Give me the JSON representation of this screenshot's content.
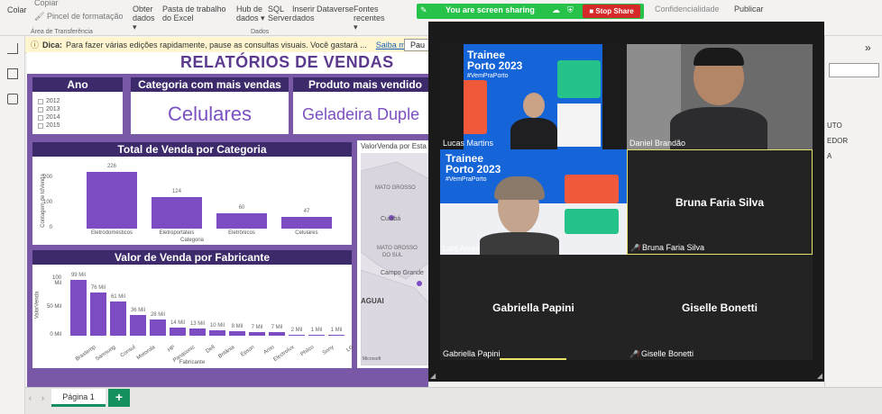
{
  "ribbon": {
    "items": [
      {
        "label": "Colar"
      },
      {
        "label": "Copiar"
      },
      {
        "label": "Pincel de formatação"
      },
      {
        "label": "Obter dados ▾"
      },
      {
        "label": "Pasta de trabalho do Excel"
      },
      {
        "label": "Hub de dados ▾"
      },
      {
        "label": "SQL Server"
      },
      {
        "label": "Inserir dados"
      },
      {
        "label": "Dataverse"
      },
      {
        "label": "Fontes recentes ▾"
      },
      {
        "label": "Confidencialidade"
      },
      {
        "label": "Publicar"
      }
    ],
    "group_clipboard": "Área de Transferência",
    "group_data": "Dados"
  },
  "infobar": {
    "prefix": "Dica:",
    "text": "Para fazer várias edições rapidamente, pause as consultas visuais. Você gastará ...",
    "link": "Saiba mais",
    "pause_button": "Pau"
  },
  "report": {
    "title": "RELATÓRIOS DE VENDAS",
    "ano": {
      "header": "Ano",
      "years": [
        "2012",
        "2013",
        "2014",
        "2015"
      ]
    },
    "categoria": {
      "header": "Categoria com mais vendas",
      "value": "Celulares"
    },
    "produto": {
      "header": "Produto mais vendido",
      "value": "Geladeira Duple"
    },
    "map_title": "ValorVenda por Esta",
    "map_labels": [
      "MATO GROSSO",
      "Cuiabá",
      "MATO GROSSO",
      "DO SUL",
      "Campo Grande",
      "AGUAI",
      "Microsoft"
    ]
  },
  "chart_data": [
    {
      "type": "bar",
      "title": "Total de Venda por Categoria",
      "categories": [
        "Eletrodomésticos",
        "Eletroportáteis",
        "Eletrônicos",
        "Celulares"
      ],
      "values": [
        226,
        124,
        60,
        47
      ],
      "xlabel": "Categoria",
      "ylabel": "Contagem de IdVenda",
      "yticks": [
        "0",
        "100",
        "200"
      ],
      "ylim": [
        0,
        250
      ]
    },
    {
      "type": "bar",
      "title": "Valor de Venda por Fabricante",
      "categories": [
        "Brastemp",
        "Samsung",
        "Consul",
        "Motorola",
        "HP",
        "Panasonic",
        "Dell",
        "Britânia",
        "Epson",
        "Arno",
        "Electrolux",
        "Philco",
        "Sony",
        "LG"
      ],
      "values": [
        99,
        76,
        61,
        36,
        28,
        14,
        13,
        10,
        8,
        7,
        7,
        2,
        1,
        1
      ],
      "value_labels": [
        "99 Mil",
        "76 Mil",
        "61 Mil",
        "36 Mil",
        "28 Mil",
        "14 Mil",
        "13 Mil",
        "10 Mil",
        "8 Mil",
        "7 Mil",
        "7 Mil",
        "2 Mil",
        "1 Mil",
        "1 Mil"
      ],
      "xlabel": "Fabricante",
      "ylabel": "ValorVenda",
      "yticks": [
        "0 Mil",
        "50 Mil",
        "100 Mil"
      ],
      "ylim": [
        0,
        110
      ]
    }
  ],
  "tabs": {
    "page1": "Página 1",
    "add": "+"
  },
  "zoom": {
    "sharing_text": "You are screen sharing",
    "stop_share": "Stop Share",
    "participants": [
      {
        "name": "Lucas Martins",
        "video": true
      },
      {
        "name": "Daniel Brandão",
        "video": true
      },
      {
        "name": "Laís Alves",
        "video": true
      },
      {
        "name": "Bruna Faria Silva",
        "video": false,
        "muted": true
      },
      {
        "name": "Gabriella Papini",
        "video": false,
        "muted": false
      },
      {
        "name": "Giselle Bonetti",
        "video": false,
        "muted": true
      }
    ],
    "slide_title_line1": "Trainee",
    "slide_title_line2": "Porto 2023",
    "slide_tag": "#VemPraPorto"
  },
  "right_panel": {
    "texts": [
      "UTO",
      "EDOR",
      "A"
    ]
  },
  "colors": {
    "report_purple": "#7a58a8",
    "bar_purple": "#7b4cc2",
    "header_dark": "#3d2a6b",
    "zoom_green": "#27c24a",
    "stop_red": "#d62a2a",
    "tab_green": "#148f5e"
  }
}
